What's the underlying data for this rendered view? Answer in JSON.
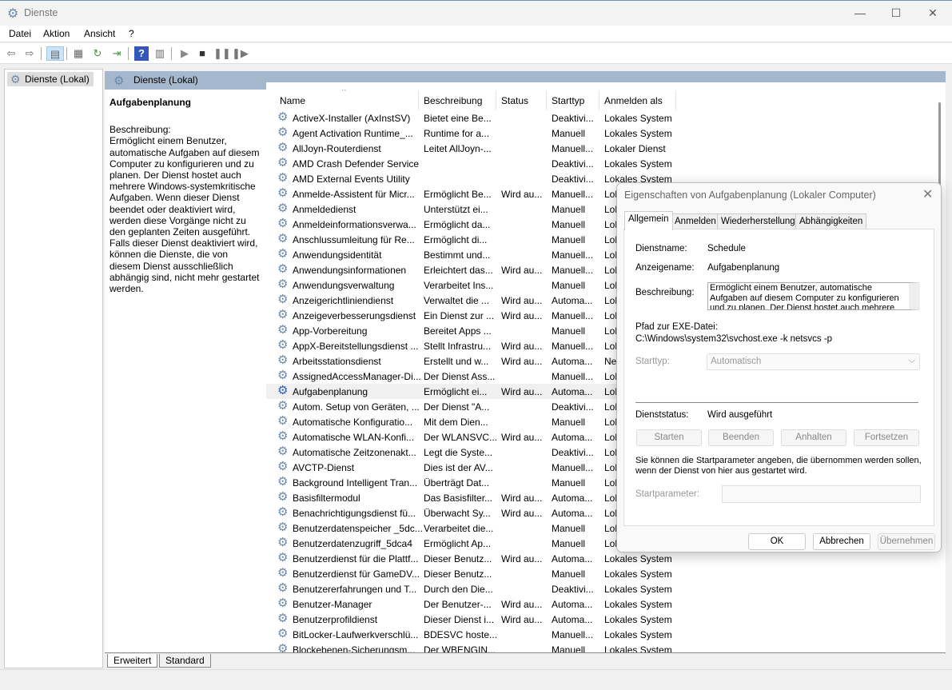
{
  "window": {
    "title": "Dienste",
    "minimize": "—",
    "maximize": "☐",
    "close": "✕"
  },
  "menu": [
    "Datei",
    "Aktion",
    "Ansicht",
    "?"
  ],
  "toolbar": [
    "back-icon",
    "forward-icon",
    "show-hide-console-tree-icon",
    "properties-icon",
    "refresh-icon",
    "export-list-icon",
    "help-icon",
    "view-icon",
    "start-icon",
    "stop-icon",
    "pause-icon",
    "restart-icon"
  ],
  "tree": {
    "item": "Dienste (Lokal)"
  },
  "header": {
    "title": "Dienste (Lokal)"
  },
  "details": {
    "title": "Aufgabenplanung",
    "desc_label": "Beschreibung:",
    "desc": "Ermöglicht einem Benutzer, automatische Aufgaben auf diesem Computer zu konfigurieren und zu planen. Der Dienst hostet auch mehrere Windows-systemkritische Aufgaben. Wenn dieser Dienst beendet oder deaktiviert wird, werden diese Vorgänge nicht zu den geplanten Zeiten ausgeführt. Falls dieser Dienst deaktiviert wird, können die Dienste, die von diesem Dienst ausschließlich abhängig sind, nicht mehr gestartet werden."
  },
  "columns": [
    "Name",
    "Beschreibung",
    "Status",
    "Starttyp",
    "Anmelden als"
  ],
  "rows": [
    [
      "ActiveX-Installer (AxInstSV)",
      "Bietet eine Be...",
      "",
      "Deaktivi...",
      "Lokales System"
    ],
    [
      "Agent Activation Runtime_...",
      "Runtime for a...",
      "",
      "Manuell",
      "Lokales System"
    ],
    [
      "AllJoyn-Routerdienst",
      "Leitet AllJoyn-...",
      "",
      "Manuell...",
      "Lokaler Dienst"
    ],
    [
      "AMD Crash Defender Service",
      "",
      "",
      "Deaktivi...",
      "Lokales System"
    ],
    [
      "AMD External Events Utility",
      "",
      "",
      "Deaktivi...",
      "Lokales System"
    ],
    [
      "Anmelde-Assistent für Micr...",
      "Ermöglicht Be...",
      "Wird au...",
      "Manuell...",
      "Lok"
    ],
    [
      "Anmeldedienst",
      "Unterstützt ei...",
      "",
      "Manuell",
      "Lok"
    ],
    [
      "Anmeldeinformationsverwa...",
      "Ermöglicht da...",
      "",
      "Manuell",
      "Lok"
    ],
    [
      "Anschlussumleitung für Re...",
      "Ermöglicht di...",
      "",
      "Manuell",
      "Lok"
    ],
    [
      "Anwendungsidentität",
      "Bestimmt und...",
      "",
      "Manuell...",
      "Lok"
    ],
    [
      "Anwendungsinformationen",
      "Erleichtert das...",
      "Wird au...",
      "Manuell...",
      "Lok"
    ],
    [
      "Anwendungsverwaltung",
      "Verarbeitet Ins...",
      "",
      "Manuell",
      "Lok"
    ],
    [
      "Anzeigerichtliniendienst",
      "Verwaltet die ...",
      "Wird au...",
      "Automa...",
      "Lok"
    ],
    [
      "Anzeigeverbesserungsdienst",
      "Ein Dienst zur ...",
      "Wird au...",
      "Manuell...",
      "Lok"
    ],
    [
      "App-Vorbereitung",
      "Bereitet Apps ...",
      "",
      "Manuell",
      "Lok"
    ],
    [
      "AppX-Bereitstellungsdienst ...",
      "Stellt Infrastru...",
      "Wird au...",
      "Manuell...",
      "Lok"
    ],
    [
      "Arbeitsstationsdienst",
      "Erstellt und w...",
      "Wird au...",
      "Automa...",
      "Net"
    ],
    [
      "AssignedAccessManager-Di...",
      "Der Dienst Ass...",
      "",
      "Manuell...",
      "Lok"
    ],
    [
      "Aufgabenplanung",
      "Ermöglicht ei...",
      "Wird au...",
      "Automa...",
      "Lok"
    ],
    [
      "Autom. Setup von Geräten, ...",
      "Der Dienst \"A...",
      "",
      "Deaktivi...",
      "Lok"
    ],
    [
      "Automatische Konfiguratio...",
      "Mit dem Dien...",
      "",
      "Manuell",
      "Lok"
    ],
    [
      "Automatische WLAN-Konfi...",
      "Der WLANSVC...",
      "Wird au...",
      "Automa...",
      "Lok"
    ],
    [
      "Automatische Zeitzonenakt...",
      "Legt die Syste...",
      "",
      "Deaktivi...",
      "Lok"
    ],
    [
      "AVCTP-Dienst",
      "Dies ist der AV...",
      "",
      "Manuell...",
      "Lok"
    ],
    [
      "Background Intelligent Tran...",
      "Überträgt Dat...",
      "",
      "Manuell",
      "Lok"
    ],
    [
      "Basisfiltermodul",
      "Das Basisfilter...",
      "Wird au...",
      "Automa...",
      "Lok"
    ],
    [
      "Benachrichtigungsdienst fü...",
      "Überwacht Sy...",
      "Wird au...",
      "Automa...",
      "Lok"
    ],
    [
      "Benutzerdatenspeicher _5dc...",
      "Verarbeitet die...",
      "",
      "Manuell",
      "Lok"
    ],
    [
      "Benutzerdatenzugriff_5dca4",
      "Ermöglicht Ap...",
      "",
      "Manuell",
      "Lok"
    ],
    [
      "Benutzerdienst für die Plattf...",
      "Dieser Benutz...",
      "Wird au...",
      "Automa...",
      "Lokales System"
    ],
    [
      "Benutzerdienst für GameDV...",
      "Dieser Benutz...",
      "",
      "Manuell",
      "Lokales System"
    ],
    [
      "Benutzererfahrungen und T...",
      "Durch den Die...",
      "",
      "Deaktivi...",
      "Lokales System"
    ],
    [
      "Benutzer-Manager",
      "Der Benutzer-...",
      "Wird au...",
      "Automa...",
      "Lokales System"
    ],
    [
      "Benutzerprofildienst",
      "Dieser Dienst i...",
      "Wird au...",
      "Automa...",
      "Lokales System"
    ],
    [
      "BitLocker-Laufwerkverschlü...",
      "BDESVC hoste...",
      "",
      "Manuell...",
      "Lokales System"
    ],
    [
      "Blockebenen-Sicherungsm...",
      "Der WBENGIN...",
      "",
      "Manuell",
      "Lokales System"
    ]
  ],
  "selected_row": 18,
  "bottom_tabs": [
    "Erweitert",
    "Standard"
  ],
  "dialog": {
    "title": "Eigenschaften von Aufgabenplanung (Lokaler Computer)",
    "tabs": [
      "Allgemein",
      "Anmelden",
      "Wiederherstellung",
      "Abhängigkeiten"
    ],
    "dienstname_label": "Dienstname:",
    "dienstname": "Schedule",
    "anzeigename_label": "Anzeigename:",
    "anzeigename": "Aufgabenplanung",
    "beschreibung_label": "Beschreibung:",
    "beschreibung": "Ermöglicht einem Benutzer, automatische Aufgaben auf diesem Computer zu konfigurieren und zu planen. Der Dienst hostet auch mehrere Windows-",
    "pfad_label": "Pfad zur EXE-Datei:",
    "pfad": "C:\\Windows\\system32\\svchost.exe -k netsvcs -p",
    "starttyp_label": "Starttyp:",
    "starttyp": "Automatisch",
    "status_label": "Dienststatus:",
    "status": "Wird ausgeführt",
    "buttons": [
      "Starten",
      "Beenden",
      "Anhalten",
      "Fortsetzen"
    ],
    "hint": "Sie können die Startparameter angeben, die übernommen werden sollen, wenn der Dienst von hier aus gestartet wird.",
    "param_label": "Startparameter:",
    "ok": "OK",
    "cancel": "Abbrechen",
    "apply": "Übernehmen"
  }
}
